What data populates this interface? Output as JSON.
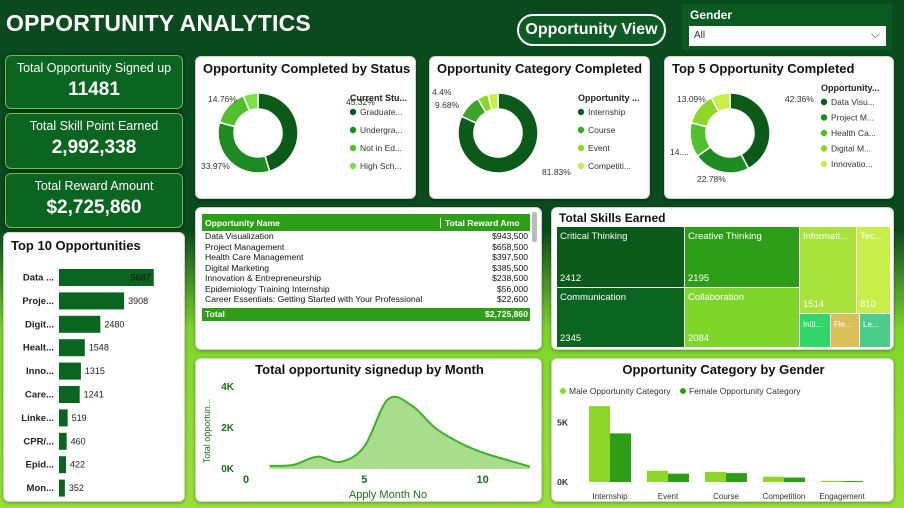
{
  "header": {
    "title": "OPPORTUNITY ANALYTICS",
    "view_button": "Opportunity View",
    "filter_label": "Gender",
    "filter_value": "All"
  },
  "kpis": [
    {
      "label": "Total Opportunity Signed up",
      "value": "11481"
    },
    {
      "label": "Total Skill Point Earned",
      "value": "2,992,338"
    },
    {
      "label": "Total Reward Amount",
      "value": "$2,725,860"
    }
  ],
  "colors": {
    "dark_green": "#0b5a1a",
    "mid_green": "#2e9e18",
    "light_green": "#8fd62b",
    "lime": "#c8ee4a"
  },
  "chart_data": [
    {
      "type": "pie",
      "title": "Opportunity Completed by Status",
      "legend_title": "Current Stu...",
      "categories": [
        "Graduate...",
        "Undergra...",
        "Not in Ed...",
        "High Sch..."
      ],
      "values": [
        45.32,
        33.97,
        14.76,
        5.95
      ],
      "labels": [
        "45.32%",
        "33.97%",
        "14.76%",
        ""
      ],
      "colors": [
        "#0b5a1a",
        "#1e8a22",
        "#52c02c",
        "#7be04a"
      ]
    },
    {
      "type": "pie",
      "title": "Opportunity Category Completed",
      "legend_title": "Opportunity ...",
      "categories": [
        "Internship",
        "Course",
        "Event",
        "Competiti..."
      ],
      "values": [
        81.83,
        9.68,
        4.4,
        4.09
      ],
      "labels": [
        "81.83%",
        "9.68%",
        "4.4%",
        ""
      ],
      "colors": [
        "#0b5a1a",
        "#3aa52a",
        "#8fd62b",
        "#c8ee4a"
      ]
    },
    {
      "type": "pie",
      "title": "Top 5 Opportunity Completed",
      "legend_title": "Opportunity...",
      "categories": [
        "Data Visu...",
        "Project M...",
        "Health Ca...",
        "Digital M...",
        "Innovatio..."
      ],
      "values": [
        42.36,
        22.78,
        14.0,
        13.09,
        7.77
      ],
      "labels": [
        "42.36%",
        "22.78%",
        "14....",
        "13.09%",
        ""
      ],
      "colors": [
        "#0b5a1a",
        "#1e8a22",
        "#52c02c",
        "#8fd62b",
        "#c8ee4a"
      ]
    },
    {
      "type": "bar",
      "title": "Top 10 Opportunities",
      "categories": [
        "Data ...",
        "Proje...",
        "Digit...",
        "Healt...",
        "Inno...",
        "Care...",
        "Linke...",
        "CPR/...",
        "Epid...",
        "Mon..."
      ],
      "values": [
        5687,
        3908,
        2480,
        1548,
        1315,
        1241,
        519,
        460,
        422,
        352
      ],
      "xlim": [
        0,
        6000
      ]
    },
    {
      "type": "table",
      "columns": [
        "Opportunity Name",
        "Total Reward Amo"
      ],
      "rows": [
        [
          "Data Visualization",
          "$943,500"
        ],
        [
          "Project Management",
          "$658,500"
        ],
        [
          "Health Care Management",
          "$397,500"
        ],
        [
          "Digital Marketing",
          "$385,500"
        ],
        [
          "Innovation & Entrepreneurship",
          "$238,500"
        ],
        [
          "Epidemiology Training Internship",
          "$56,000"
        ],
        [
          "Career Essentials: Getting Started with Your Professional",
          "$22,600"
        ]
      ],
      "total": [
        "Total",
        "$2,725,860"
      ]
    },
    {
      "type": "heatmap",
      "title": "Total Skills Earned",
      "items": [
        {
          "name": "Critical Thinking",
          "value": 2412
        },
        {
          "name": "Creative Thinking",
          "value": 2195
        },
        {
          "name": "Communication",
          "value": 2345
        },
        {
          "name": "Collaboration",
          "value": 2084
        },
        {
          "name": "Informati...",
          "value": 1514
        },
        {
          "name": "Tec...",
          "value": 810
        },
        {
          "name": "Initi...",
          "value": ""
        },
        {
          "name": "Fle...",
          "value": ""
        },
        {
          "name": "Le...",
          "value": ""
        }
      ]
    },
    {
      "type": "area",
      "title": "Total opportunity signedup by Month",
      "xlabel": "Apply Month No",
      "ylabel": "Total opportun...",
      "x": [
        1,
        2,
        3,
        4,
        5,
        6,
        7,
        8,
        9,
        10,
        11,
        12
      ],
      "y": [
        150,
        200,
        600,
        350,
        1100,
        3400,
        3100,
        2000,
        1300,
        800,
        450,
        120
      ],
      "xticks": [
        "0",
        "5",
        "10"
      ],
      "xtick_values": [
        0,
        5,
        10
      ],
      "yticks": [
        "0K",
        "2K",
        "4K"
      ],
      "ytick_values": [
        0,
        2000,
        4000
      ],
      "xlim": [
        0,
        12
      ],
      "ylim": [
        0,
        4000
      ]
    },
    {
      "type": "bar",
      "title": "Opportunity Category by Gender",
      "categories": [
        "Internship",
        "Event",
        "Course",
        "Competition",
        "Engagement"
      ],
      "series": [
        {
          "name": "Male Opportunity Category",
          "values": [
            6400,
            950,
            850,
            450,
            100
          ],
          "color": "#8fd62b"
        },
        {
          "name": "Female Opportunity Category",
          "values": [
            4100,
            700,
            750,
            380,
            80
          ],
          "color": "#2e9e18"
        }
      ],
      "yticks": [
        "0K",
        "5K"
      ],
      "ytick_values": [
        0,
        5000
      ],
      "ylim": [
        0,
        7000
      ]
    }
  ]
}
